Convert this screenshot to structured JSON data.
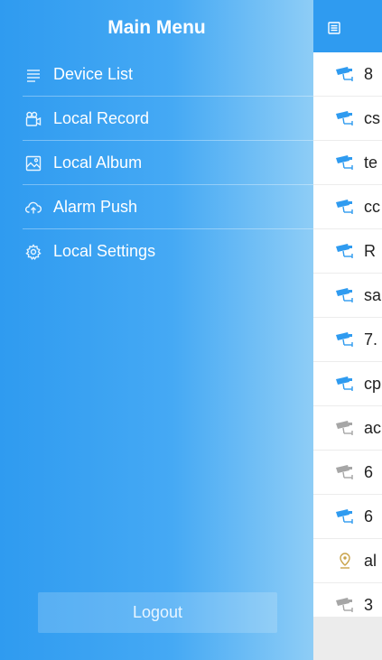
{
  "drawer": {
    "title": "Main Menu",
    "items": [
      {
        "label": "Device List",
        "icon": "list-icon"
      },
      {
        "label": "Local Record",
        "icon": "camera-record-icon"
      },
      {
        "label": "Local Album",
        "icon": "image-icon"
      },
      {
        "label": "Alarm Push",
        "icon": "cloud-upload-icon"
      },
      {
        "label": "Local Settings",
        "icon": "gear-icon"
      }
    ],
    "logout_label": "Logout"
  },
  "main": {
    "header_icon": "list-icon",
    "devices": [
      {
        "name": "8",
        "icon": "camera-icon",
        "status": "online"
      },
      {
        "name": "cs",
        "icon": "camera-icon",
        "status": "online"
      },
      {
        "name": "te",
        "icon": "camera-icon",
        "status": "online"
      },
      {
        "name": "cc",
        "icon": "camera-icon",
        "status": "online"
      },
      {
        "name": "R",
        "icon": "camera-icon",
        "status": "online"
      },
      {
        "name": "sa",
        "icon": "camera-icon",
        "status": "online"
      },
      {
        "name": "7.",
        "icon": "camera-icon",
        "status": "online"
      },
      {
        "name": "cp",
        "icon": "camera-icon",
        "status": "online"
      },
      {
        "name": "ac",
        "icon": "camera-icon",
        "status": "offline"
      },
      {
        "name": "6",
        "icon": "camera-icon",
        "status": "offline"
      },
      {
        "name": "6",
        "icon": "camera-icon",
        "status": "online"
      },
      {
        "name": "al",
        "icon": "location-pin-icon",
        "status": "offline"
      },
      {
        "name": "3",
        "icon": "camera-icon",
        "status": "offline"
      }
    ]
  },
  "colors": {
    "accent": "#2f9bf0",
    "online_icon": "#2f9bf0",
    "offline_icon": "#a6a6a6",
    "pin_icon": "#c9a34a"
  }
}
